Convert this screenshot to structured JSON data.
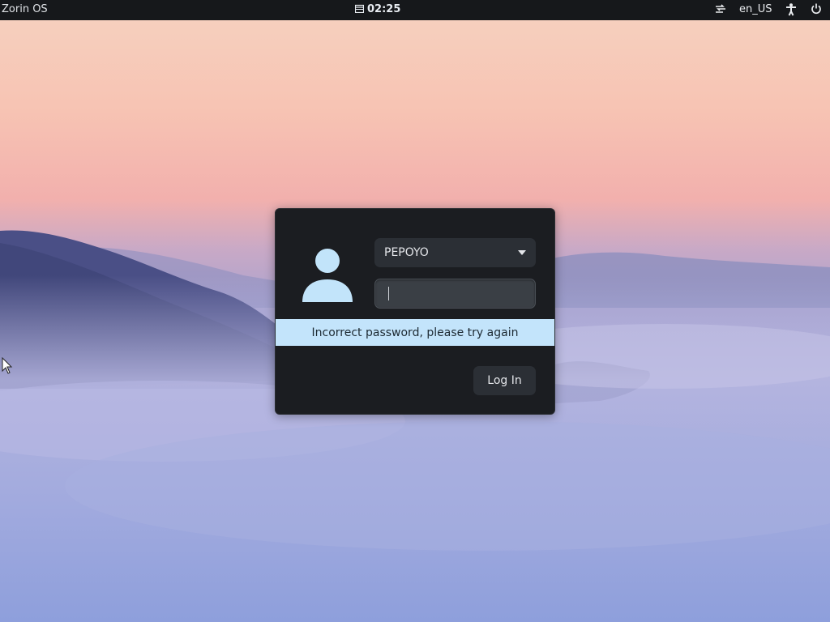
{
  "topbar": {
    "os_name": "Zorin OS",
    "clock": "02:25",
    "calendar_icon": "calendar-icon",
    "network_icon": "network-icon",
    "language": "en_US",
    "accessibility_icon": "accessibility-icon",
    "power_icon": "power-icon"
  },
  "login": {
    "username": "PEPOYO",
    "password_value": "",
    "error_message": "Incorrect password, please try again",
    "login_button": "Log In"
  },
  "colors": {
    "topbar_bg": "#16181b",
    "dialog_bg": "#1b1d21",
    "error_bg": "#c3e4fb",
    "avatar": "#c2e4fa"
  }
}
